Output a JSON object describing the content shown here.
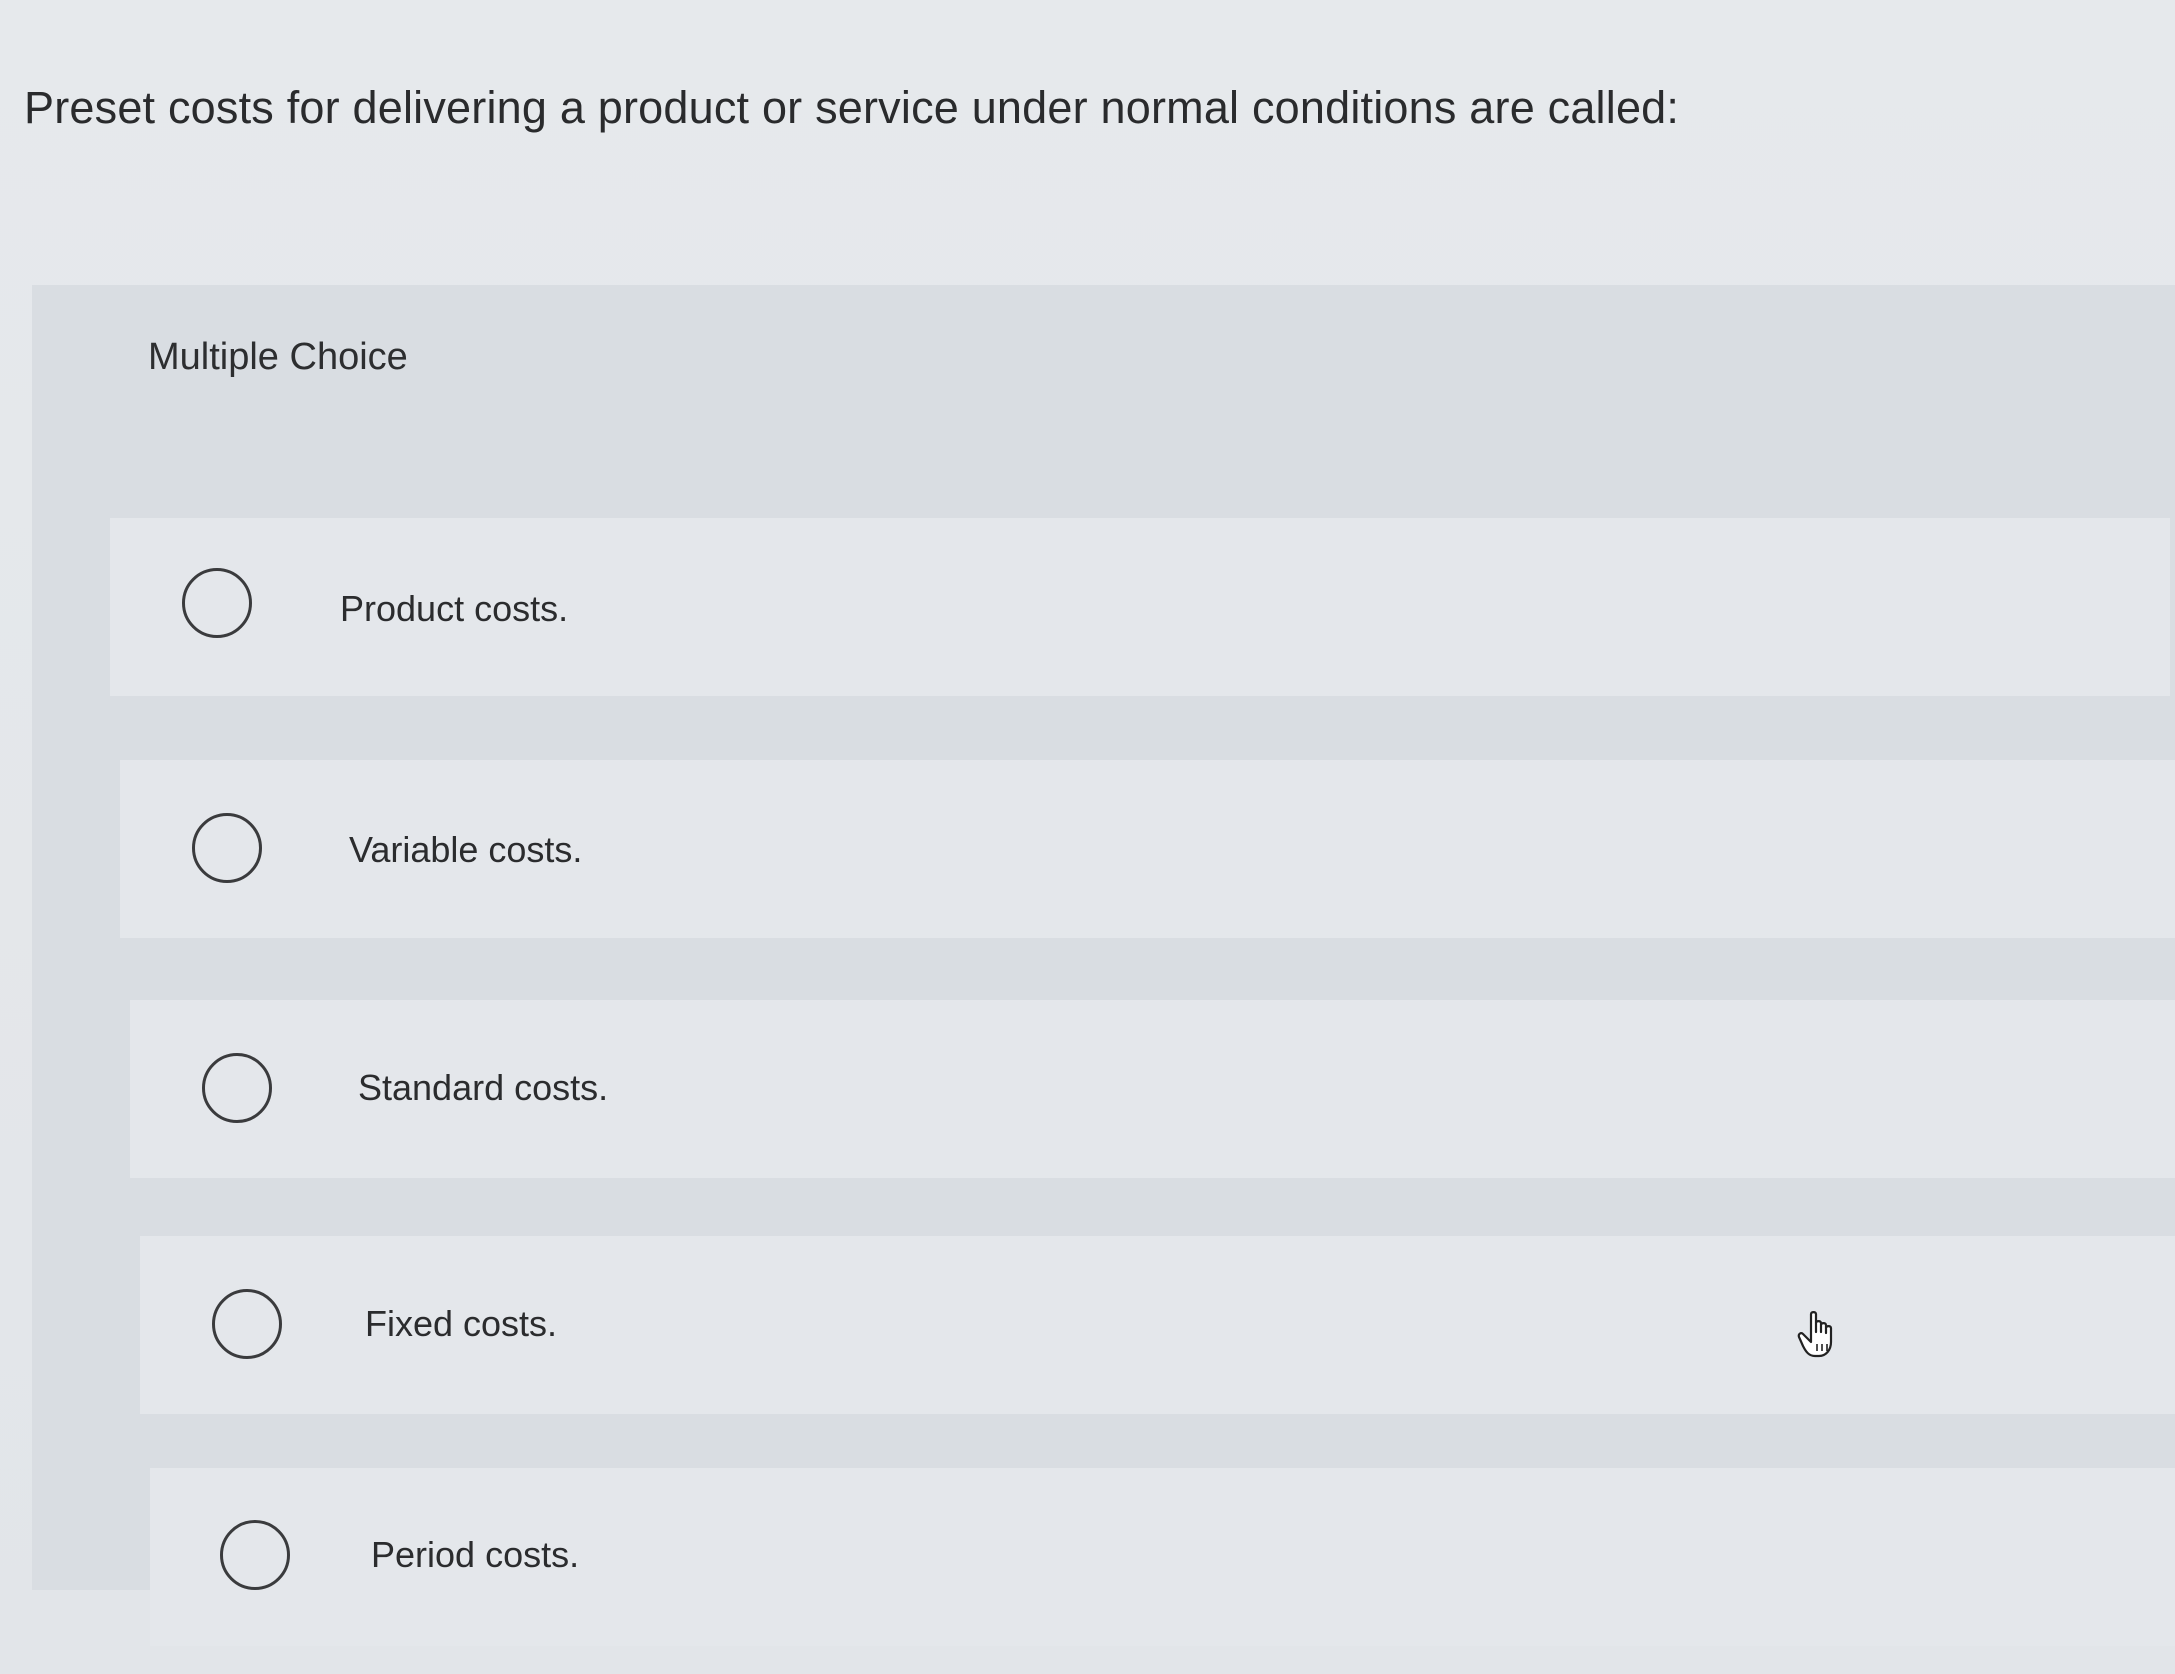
{
  "question": {
    "text": "Preset costs for delivering a product or service under normal conditions are called:"
  },
  "multiple_choice": {
    "label": "Multiple Choice",
    "options": [
      {
        "label": "Product costs.",
        "selected": false
      },
      {
        "label": "Variable costs.",
        "selected": false
      },
      {
        "label": "Standard costs.",
        "selected": false
      },
      {
        "label": "Fixed costs.",
        "selected": false
      },
      {
        "label": "Period costs.",
        "selected": false
      }
    ]
  },
  "cursor": {
    "icon": "hand-pointer-icon"
  }
}
